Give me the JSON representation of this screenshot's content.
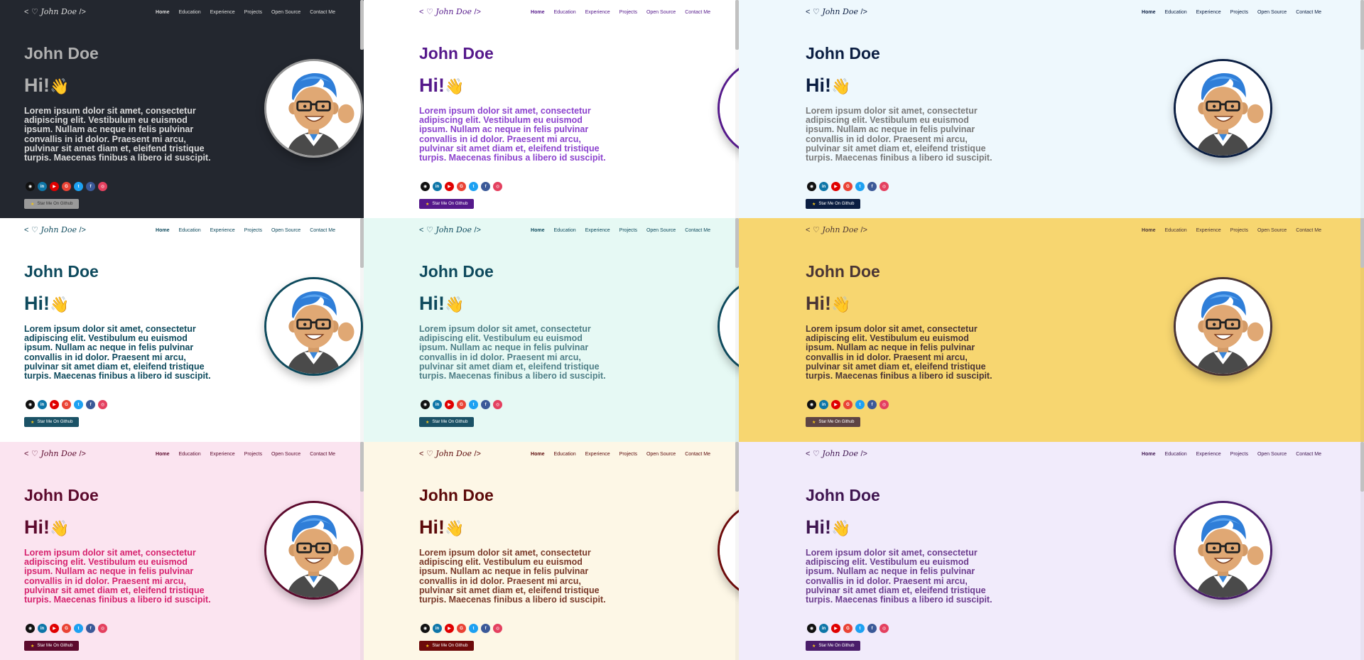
{
  "panels": [
    {
      "theme": "dark",
      "bg": "#23272f",
      "text": "#b5b5b5",
      "name_color": "#b0b0b0",
      "lorem_color": "#d9d9d9",
      "nav_color": "#dddddd",
      "btn_bg": "#9a9a9a",
      "btn_text": "#333333",
      "ring": "#999999"
    },
    {
      "theme": "purple",
      "bg": "#ffffff",
      "text": "#55198b",
      "name_color": "#55198b",
      "lorem_color": "#8c43ce",
      "nav_color": "#55198b",
      "btn_bg": "#55198b",
      "btn_text": "#ffffff",
      "ring": "#55198b"
    },
    {
      "theme": "light-blue",
      "bg": "#eef8fd",
      "text": "#0b1e42",
      "name_color": "#0b1e42",
      "lorem_color": "#7a7a7a",
      "nav_color": "#0b1e42",
      "btn_bg": "#0b1e42",
      "btn_text": "#ffffff",
      "ring": "#0b1e42"
    },
    {
      "theme": "teal",
      "bg": "#ffffff",
      "text": "#0e4a5d",
      "name_color": "#0e4a5d",
      "lorem_color": "#0e4a5d",
      "nav_color": "#0e4a5d",
      "btn_bg": "#1b5266",
      "btn_text": "#ffffff",
      "ring": "#0e4a5d"
    },
    {
      "theme": "mint",
      "bg": "#e6f9f4",
      "text": "#0e4a5d",
      "name_color": "#0e4a5d",
      "lorem_color": "#4f7f87",
      "nav_color": "#0e4a5d",
      "btn_bg": "#1b5266",
      "btn_text": "#ffffff",
      "ring": "#0e4a5d"
    },
    {
      "theme": "yellow",
      "bg": "#f7d670",
      "text": "#4a3535",
      "name_color": "#4a3535",
      "lorem_color": "#4a3535",
      "nav_color": "#4a3535",
      "btn_bg": "#5e4444",
      "btn_text": "#ffffff",
      "ring": "#4a3535"
    },
    {
      "theme": "pink",
      "bg": "#fbe4f0",
      "text": "#5c0a2d",
      "name_color": "#5c0a2d",
      "lorem_color": "#d6226e",
      "nav_color": "#5c0a2d",
      "btn_bg": "#5c0a2d",
      "btn_text": "#ffffff",
      "ring": "#5c0a2d"
    },
    {
      "theme": "cream",
      "bg": "#fdf7e6",
      "text": "#5c0a0a",
      "name_color": "#5c0a0a",
      "lorem_color": "#7a3a2a",
      "nav_color": "#5c0a0a",
      "btn_bg": "#6d0a0a",
      "btn_text": "#ffffff",
      "ring": "#6d0a0a"
    },
    {
      "theme": "lavender",
      "bg": "#f1ebfb",
      "text": "#3f1550",
      "name_color": "#3f1550",
      "lorem_color": "#6d3d8f",
      "nav_color": "#3f1550",
      "btn_bg": "#4a1d6a",
      "btn_text": "#ffffff",
      "ring": "#4a1d6a"
    }
  ],
  "content": {
    "logo_left": "<",
    "logo_name": "John Doe",
    "logo_right": "/>",
    "nav": [
      "Home",
      "Education",
      "Experience",
      "Projects",
      "Open Source",
      "Contact Me"
    ],
    "name": "John Doe",
    "greeting": "Hi!",
    "wave": "👋",
    "lorem": "Lorem ipsum dolor sit amet, consectetur adipiscing elit. Vestibulum eu euismod ipsum. Nullam ac neque in felis pulvinar convallis in id dolor. Praesent mi arcu, pulvinar sit amet diam et, eleifend tristique turpis. Maecenas finibus a libero id suscipit.",
    "socials": [
      {
        "icon": "github-icon",
        "glyph": "◉",
        "color": "#111111"
      },
      {
        "icon": "linkedin-icon",
        "glyph": "in",
        "color": "#0e76a8"
      },
      {
        "icon": "youtube-icon",
        "glyph": "▶",
        "color": "#e00000"
      },
      {
        "icon": "google-icon",
        "glyph": "G",
        "color": "#ea4335"
      },
      {
        "icon": "twitter-icon",
        "glyph": "t",
        "color": "#1da1f2"
      },
      {
        "icon": "facebook-icon",
        "glyph": "f",
        "color": "#3b5998"
      },
      {
        "icon": "instagram-icon",
        "glyph": "◎",
        "color": "#e4405f"
      }
    ],
    "star_icon": "★",
    "star_label": "Star Me On Github"
  }
}
